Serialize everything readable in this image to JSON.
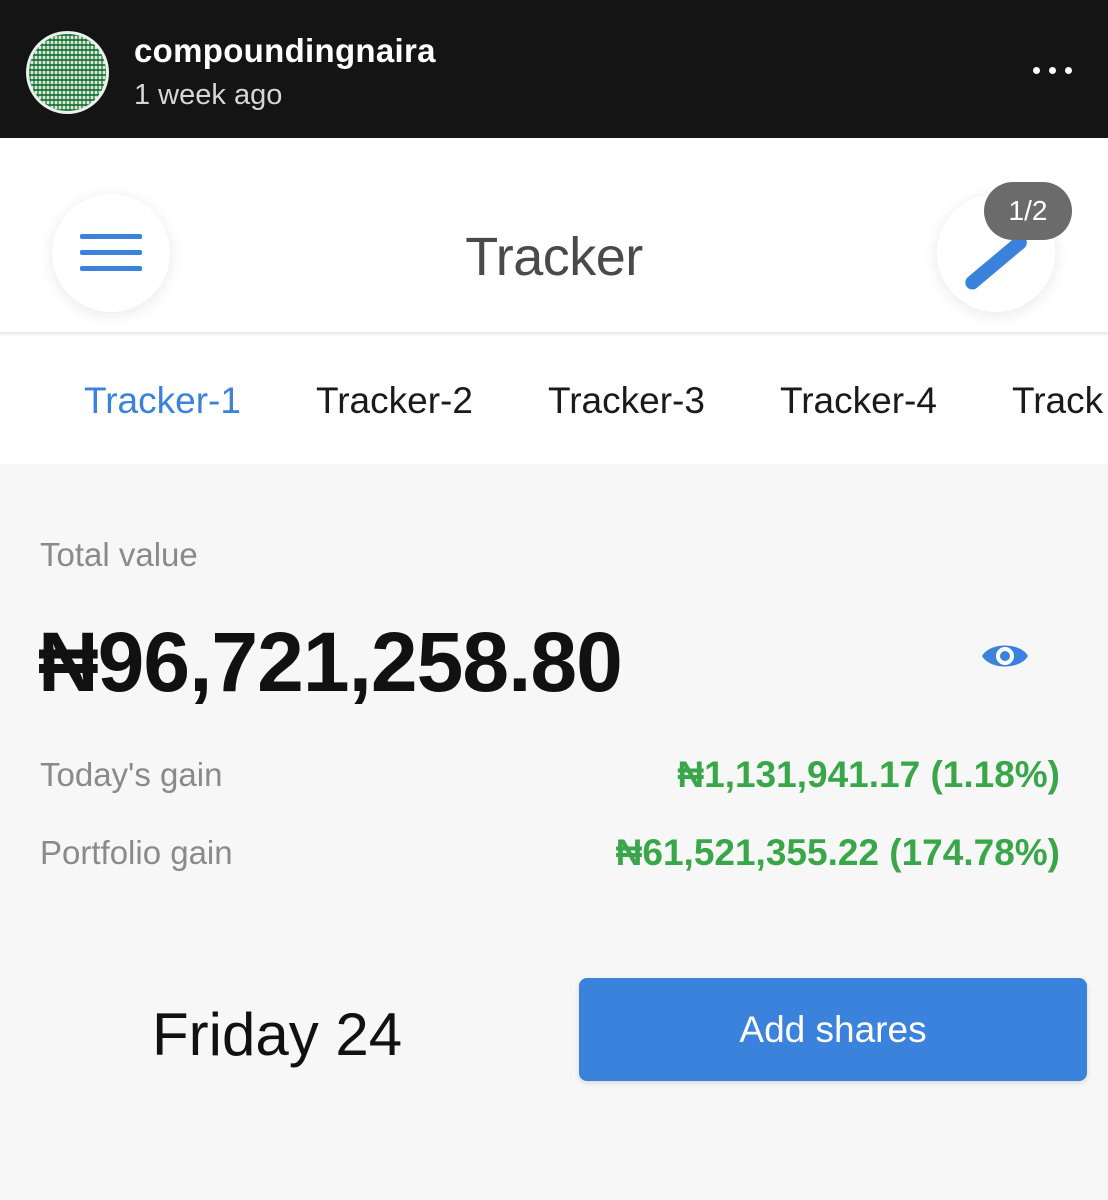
{
  "story": {
    "username": "compoundingnaira",
    "time_ago": "1 week ago"
  },
  "app": {
    "title": "Tracker",
    "page_badge": "1/2"
  },
  "tabs": [
    {
      "label": "Tracker-1",
      "active": true
    },
    {
      "label": "Tracker-2",
      "active": false
    },
    {
      "label": "Tracker-3",
      "active": false
    },
    {
      "label": "Tracker-4",
      "active": false
    },
    {
      "label": "Track",
      "active": false
    }
  ],
  "summary": {
    "total_label": "Total value",
    "total_value": "₦96,721,258.80",
    "todays_gain_label": "Today's gain",
    "todays_gain_value": "₦1,131,941.17 (1.18%)",
    "portfolio_gain_label": "Portfolio gain",
    "portfolio_gain_value": "₦61,521,355.22 (174.78%)"
  },
  "footer": {
    "date": "Friday 24",
    "add_shares_label": "Add shares"
  },
  "icons": {
    "menu": "hamburger-menu-icon",
    "edit": "pencil-icon",
    "visibility": "eye-icon",
    "more": "more-horizontal-icon"
  },
  "colors": {
    "accent": "#3b82dc",
    "gain": "#3aa64a",
    "header_bg": "#141414"
  }
}
